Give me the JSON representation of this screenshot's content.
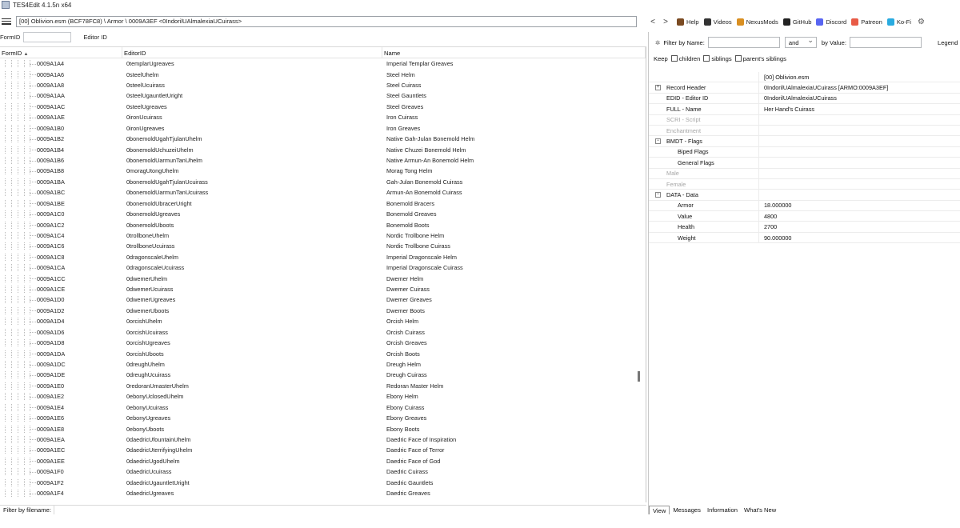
{
  "window": {
    "title": "TES4Edit 4.1.5n x64"
  },
  "path": {
    "value": "[00] Oblivion.esm (BCF78FC8) \\ Armor \\ 0009A3EF <0IndorilUAlmalexiaUCuirass>"
  },
  "nav": {
    "back": "<",
    "forward": ">",
    "links": [
      {
        "label": "Help",
        "icon": "book-icon",
        "color": "#7a4a22"
      },
      {
        "label": "Videos",
        "icon": "film-icon",
        "color": "#333333"
      },
      {
        "label": "NexusMods",
        "icon": "nexus-icon",
        "color": "#d98f21"
      },
      {
        "label": "GitHub",
        "icon": "github-icon",
        "color": "#222222"
      },
      {
        "label": "Discord",
        "icon": "discord-icon",
        "color": "#5865f2"
      },
      {
        "label": "Patreon",
        "icon": "patreon-icon",
        "color": "#e85b46"
      },
      {
        "label": "Ko-Fi",
        "icon": "kofi-icon",
        "color": "#29abe0"
      }
    ],
    "settings_icon": "gear-icon"
  },
  "filters": {
    "formid_label": "FormID",
    "editorid_label": "Editor ID"
  },
  "columns": {
    "formid": "FormID",
    "editorid": "EditorID",
    "name": "Name",
    "sort": "▲"
  },
  "records": [
    {
      "formid": "0009A1A4",
      "editorid": "0templarUgreaves",
      "name": "Imperial Templar Greaves"
    },
    {
      "formid": "0009A1A6",
      "editorid": "0steelUhelm",
      "name": "Steel Helm"
    },
    {
      "formid": "0009A1A8",
      "editorid": "0steelUcuirass",
      "name": "Steel Cuirass"
    },
    {
      "formid": "0009A1AA",
      "editorid": "0steelUgauntletUright",
      "name": "Steel Gauntlets"
    },
    {
      "formid": "0009A1AC",
      "editorid": "0steelUgreaves",
      "name": "Steel Greaves"
    },
    {
      "formid": "0009A1AE",
      "editorid": "0ironUcuirass",
      "name": "Iron Cuirass"
    },
    {
      "formid": "0009A1B0",
      "editorid": "0ironUgreaves",
      "name": "Iron Greaves"
    },
    {
      "formid": "0009A1B2",
      "editorid": "0bonemoldUgahTjulanUhelm",
      "name": "Native Gah-Julan Bonemold Helm"
    },
    {
      "formid": "0009A1B4",
      "editorid": "0bonemoldUchuzeiUhelm",
      "name": "Native Chuzei Bonemold Helm"
    },
    {
      "formid": "0009A1B6",
      "editorid": "0bonemoldUarmunTanUhelm",
      "name": "Native Armun-An Bonemold Helm"
    },
    {
      "formid": "0009A1B8",
      "editorid": "0moragUtongUhelm",
      "name": "Morag Tong Helm"
    },
    {
      "formid": "0009A1BA",
      "editorid": "0bonemoldUgahTjulanUcuirass",
      "name": "Gah-Julan Bonemold Cuirass"
    },
    {
      "formid": "0009A1BC",
      "editorid": "0bonemoldUarmunTanUcuirass",
      "name": "Armun-An Bonemold Cuirass"
    },
    {
      "formid": "0009A1BE",
      "editorid": "0bonemoldUbracerUright",
      "name": "Bonemold Bracers"
    },
    {
      "formid": "0009A1C0",
      "editorid": "0bonemoldUgreaves",
      "name": "Bonemold Greaves"
    },
    {
      "formid": "0009A1C2",
      "editorid": "0bonemoldUboots",
      "name": "Bonemold Boots"
    },
    {
      "formid": "0009A1C4",
      "editorid": "0trollboneUhelm",
      "name": "Nordic Trollbone Helm"
    },
    {
      "formid": "0009A1C6",
      "editorid": "0trollboneUcuirass",
      "name": "Nordic Trollbone Cuirass"
    },
    {
      "formid": "0009A1C8",
      "editorid": "0dragonscaleUhelm",
      "name": "Imperial Dragonscale Helm"
    },
    {
      "formid": "0009A1CA",
      "editorid": "0dragonscaleUcuirass",
      "name": "Imperial Dragonscale Cuirass"
    },
    {
      "formid": "0009A1CC",
      "editorid": "0dwemerUhelm",
      "name": "Dwemer Helm"
    },
    {
      "formid": "0009A1CE",
      "editorid": "0dwemerUcuirass",
      "name": "Dwemer Cuirass"
    },
    {
      "formid": "0009A1D0",
      "editorid": "0dwemerUgreaves",
      "name": "Dwemer Greaves"
    },
    {
      "formid": "0009A1D2",
      "editorid": "0dwemerUboots",
      "name": "Dwemer Boots"
    },
    {
      "formid": "0009A1D4",
      "editorid": "0orcishUhelm",
      "name": "Orcish Helm"
    },
    {
      "formid": "0009A1D6",
      "editorid": "0orcishUcuirass",
      "name": "Orcish Cuirass"
    },
    {
      "formid": "0009A1D8",
      "editorid": "0orcishUgreaves",
      "name": "Orcish Greaves"
    },
    {
      "formid": "0009A1DA",
      "editorid": "0orcishUboots",
      "name": "Orcish Boots"
    },
    {
      "formid": "0009A1DC",
      "editorid": "0dreughUhelm",
      "name": "Dreugh Helm"
    },
    {
      "formid": "0009A1DE",
      "editorid": "0dreughUcuirass",
      "name": "Dreugh Cuirass"
    },
    {
      "formid": "0009A1E0",
      "editorid": "0redoranUmasterUhelm",
      "name": "Redoran Master Helm"
    },
    {
      "formid": "0009A1E2",
      "editorid": "0ebonyUclosedUhelm",
      "name": "Ebony Helm"
    },
    {
      "formid": "0009A1E4",
      "editorid": "0ebonyUcuirass",
      "name": "Ebony Cuirass"
    },
    {
      "formid": "0009A1E6",
      "editorid": "0ebonyUgreaves",
      "name": "Ebony Greaves"
    },
    {
      "formid": "0009A1E8",
      "editorid": "0ebonyUboots",
      "name": "Ebony Boots"
    },
    {
      "formid": "0009A1EA",
      "editorid": "0daedricUfountainUhelm",
      "name": "Daedric Face of Inspiration"
    },
    {
      "formid": "0009A1EC",
      "editorid": "0daedricUterrifyingUhelm",
      "name": "Daedric Face of Terror"
    },
    {
      "formid": "0009A1EE",
      "editorid": "0daedricUgodUhelm",
      "name": "Daedric Face of God"
    },
    {
      "formid": "0009A1F0",
      "editorid": "0daedricUcuirass",
      "name": "Daedric Cuirass"
    },
    {
      "formid": "0009A1F2",
      "editorid": "0daedricUgauntletUright",
      "name": "Daedric Gauntlets"
    },
    {
      "formid": "0009A1F4",
      "editorid": "0daedricUgreaves",
      "name": "Daedric Greaves"
    }
  ],
  "filename_filter": {
    "label": "Filter by filename:"
  },
  "record_view": {
    "filter_by_name_label": "Filter by Name:",
    "operator": "and",
    "by_value_label": "by Value:",
    "legend_label": "Legend",
    "keep_label": "Keep",
    "keep_options": [
      "children",
      "siblings",
      "parent's siblings"
    ],
    "file_header": "[00] Oblivion.esm",
    "fields": [
      {
        "key": "Record Header",
        "value": "0IndorilUAlmalexiaUCuirass [ARMO:0009A3EF]",
        "expander": "+",
        "level": 0
      },
      {
        "key": "EDID - Editor ID",
        "value": "0IndorilUAlmalexiaUCuirass",
        "level": 0
      },
      {
        "key": "FULL - Name",
        "value": "Her Hand's Cuirass",
        "level": 0
      },
      {
        "key": "SCRI - Script",
        "value": "",
        "level": 0,
        "greyed": true
      },
      {
        "key": "Enchantment",
        "value": "",
        "level": 0,
        "greyed": true
      },
      {
        "key": "BMDT - Flags",
        "value": "",
        "expander": "−",
        "level": 0
      },
      {
        "key": "Biped Flags",
        "value": "",
        "level": 1
      },
      {
        "key": "General Flags",
        "value": "",
        "level": 1
      },
      {
        "key": "Male",
        "value": "",
        "level": 0,
        "greyed": true
      },
      {
        "key": "Female",
        "value": "",
        "level": 0,
        "greyed": true
      },
      {
        "key": "DATA - Data",
        "value": "",
        "expander": "−",
        "level": 0
      },
      {
        "key": "Armor",
        "value": "18.000000",
        "level": 1
      },
      {
        "key": "Value",
        "value": "4800",
        "level": 1
      },
      {
        "key": "Health",
        "value": "2700",
        "level": 1
      },
      {
        "key": "Weight",
        "value": "90.000000",
        "level": 1
      }
    ],
    "tabs": [
      "View",
      "Messages",
      "Information",
      "What's New"
    ]
  }
}
